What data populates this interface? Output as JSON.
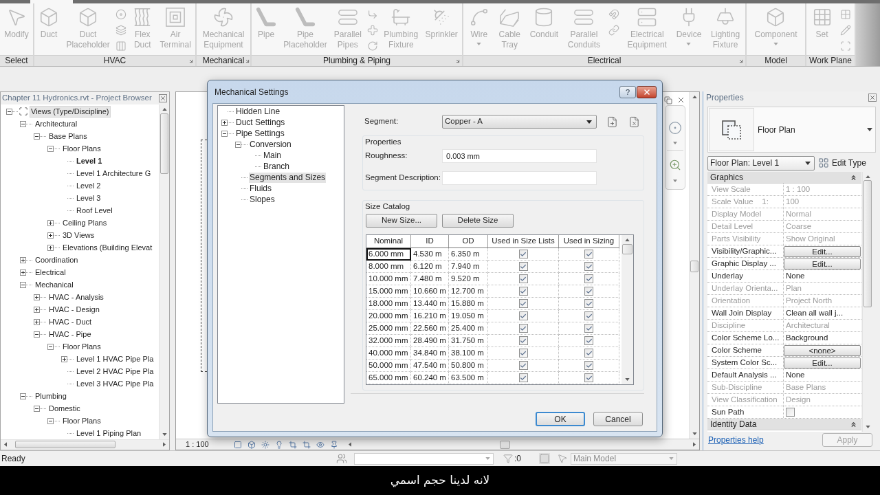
{
  "ribbon": {
    "panels": [
      {
        "title": "Select",
        "launcher": false,
        "items": [
          {
            "kind": "large",
            "label": "Modify",
            "dropdown": false,
            "disabled": true
          }
        ]
      },
      {
        "title": "HVAC",
        "launcher": true,
        "items": [
          {
            "kind": "large",
            "label": "Duct",
            "dropdown": false,
            "disabled": true
          },
          {
            "kind": "large",
            "label": "Duct Placeholder",
            "dropdown": false,
            "disabled": true
          },
          {
            "kind": "stack"
          },
          {
            "kind": "large",
            "label": "Flex Duct",
            "dropdown": false,
            "disabled": true
          },
          {
            "kind": "large",
            "label": "Air Terminal",
            "dropdown": false,
            "disabled": true
          }
        ]
      },
      {
        "title": "Mechanical",
        "launcher": true,
        "items": [
          {
            "kind": "large",
            "label": "Mechanical Equipment",
            "dropdown": false,
            "disabled": true
          }
        ]
      },
      {
        "title": "Plumbing & Piping",
        "launcher": true,
        "items": [
          {
            "kind": "large",
            "label": "Pipe",
            "dropdown": false,
            "disabled": true
          },
          {
            "kind": "large",
            "label": "Pipe Placeholder",
            "dropdown": false,
            "disabled": true
          },
          {
            "kind": "large",
            "label": "Parallel Pipes",
            "dropdown": false,
            "disabled": true
          },
          {
            "kind": "stack"
          },
          {
            "kind": "large",
            "label": "Plumbing Fixture",
            "dropdown": false,
            "disabled": true
          },
          {
            "kind": "large",
            "label": "Sprinkler",
            "dropdown": false,
            "disabled": true
          }
        ]
      },
      {
        "title": "Electrical",
        "launcher": true,
        "items": [
          {
            "kind": "large",
            "label": "Wire",
            "dropdown": true,
            "disabled": true
          },
          {
            "kind": "large",
            "label": "Cable Tray",
            "dropdown": false,
            "disabled": true
          },
          {
            "kind": "large",
            "label": "Conduit",
            "dropdown": false,
            "disabled": true
          },
          {
            "kind": "large",
            "label": "Parallel Conduits",
            "dropdown": false,
            "disabled": true
          },
          {
            "kind": "stack"
          },
          {
            "kind": "large",
            "label": "Electrical Equipment",
            "dropdown": false,
            "disabled": true
          },
          {
            "kind": "large",
            "label": "Device",
            "dropdown": true,
            "disabled": true
          },
          {
            "kind": "large",
            "label": "Lighting Fixture",
            "dropdown": false,
            "disabled": true
          }
        ]
      },
      {
        "title": "Model",
        "launcher": false,
        "items": [
          {
            "kind": "large",
            "label": "Component",
            "dropdown": true,
            "disabled": true
          }
        ]
      },
      {
        "title": "Work Plane",
        "launcher": false,
        "items": [
          {
            "kind": "large",
            "label": "Set",
            "dropdown": false,
            "disabled": true
          },
          {
            "kind": "stack"
          }
        ]
      }
    ]
  },
  "project_browser": {
    "title": "Chapter 11 Hydronics.rvt - Project Browser",
    "tree": [
      {
        "label": "Views (Type/Discipline)",
        "expanded": true,
        "selected": true,
        "children": [
          {
            "label": "Architectural",
            "expanded": true,
            "children": [
              {
                "label": "Base Plans",
                "expanded": true,
                "children": [
                  {
                    "label": "Floor Plans",
                    "expanded": true,
                    "children": [
                      {
                        "label": "Level 1",
                        "active": true
                      },
                      {
                        "label": "Level 1 Architecture G",
                        "active": false
                      },
                      {
                        "label": "Level 2",
                        "active": false
                      },
                      {
                        "label": "Level 3",
                        "active": false
                      },
                      {
                        "label": "Roof Level",
                        "active": false
                      }
                    ]
                  },
                  {
                    "label": "Ceiling Plans",
                    "expanded": false
                  },
                  {
                    "label": "3D Views",
                    "expanded": false
                  },
                  {
                    "label": "Elevations (Building Elevat",
                    "expanded": false
                  }
                ]
              }
            ]
          },
          {
            "label": "Coordination",
            "expanded": false
          },
          {
            "label": "Electrical",
            "expanded": false
          },
          {
            "label": "Mechanical",
            "expanded": true,
            "children": [
              {
                "label": "HVAC - Analysis",
                "expanded": false
              },
              {
                "label": "HVAC - Design",
                "expanded": false
              },
              {
                "label": "HVAC - Duct",
                "expanded": false
              },
              {
                "label": "HVAC - Pipe",
                "expanded": true,
                "children": [
                  {
                    "label": "Floor Plans",
                    "expanded": true,
                    "children": [
                      {
                        "label": "Level 1 HVAC Pipe Pla",
                        "expanded": false
                      },
                      {
                        "label": "Level 2 HVAC Pipe Pla"
                      },
                      {
                        "label": "Level 3 HVAC Pipe Pla"
                      }
                    ]
                  }
                ]
              }
            ]
          },
          {
            "label": "Plumbing",
            "expanded": true,
            "children": [
              {
                "label": "Domestic",
                "expanded": true,
                "children": [
                  {
                    "label": "Floor Plans",
                    "expanded": true,
                    "children": [
                      {
                        "label": "Level 1 Piping Plan"
                      }
                    ]
                  }
                ]
              }
            ]
          }
        ]
      }
    ]
  },
  "view": {
    "scale": "1 : 100"
  },
  "dialog": {
    "title": "Mechanical Settings",
    "help_button": "?",
    "tree": [
      {
        "label": "Hidden Line",
        "selected": false
      },
      {
        "label": "Duct Settings",
        "expanded": false,
        "selected": false
      },
      {
        "label": "Pipe Settings",
        "expanded": true,
        "selected": false,
        "children": [
          {
            "label": "Conversion",
            "expanded": true,
            "selected": false,
            "children": [
              {
                "label": "Main",
                "selected": false
              },
              {
                "label": "Branch",
                "selected": false
              }
            ]
          },
          {
            "label": "Segments and Sizes",
            "selected": true
          },
          {
            "label": "Fluids",
            "selected": false
          },
          {
            "label": "Slopes",
            "selected": false
          }
        ]
      }
    ],
    "segment": {
      "label": "Segment:",
      "value": "Copper - A"
    },
    "properties": {
      "title": "Properties",
      "fields": [
        {
          "label": "Roughness:",
          "value": "0.003 mm"
        },
        {
          "label": "Segment Description:"
        }
      ]
    },
    "size_catalog": {
      "title": "Size Catalog",
      "buttons": [
        "New Size...",
        "Delete Size"
      ],
      "columns": [
        "Nominal",
        "ID",
        "OD",
        "Used in Size Lists",
        "Used in Sizing"
      ],
      "rows": [
        {
          "nominal": "6.000 mm",
          "id": "4.530 m",
          "od": "6.350 m",
          "used_in_size_lists": true,
          "used_in_sizing": true,
          "focused": true
        },
        {
          "nominal": "8.000 mm",
          "id": "6.120 m",
          "od": "7.940 m",
          "used_in_size_lists": true,
          "used_in_sizing": true,
          "focused": false
        },
        {
          "nominal": "10.000 mm",
          "id": "7.480 m",
          "od": "9.520 m",
          "used_in_size_lists": true,
          "used_in_sizing": true,
          "focused": false
        },
        {
          "nominal": "15.000 mm",
          "id": "10.660 m",
          "od": "12.700 m",
          "used_in_size_lists": true,
          "used_in_sizing": true,
          "focused": false
        },
        {
          "nominal": "18.000 mm",
          "id": "13.440 m",
          "od": "15.880 m",
          "used_in_size_lists": true,
          "used_in_sizing": true,
          "focused": false
        },
        {
          "nominal": "20.000 mm",
          "id": "16.210 m",
          "od": "19.050 m",
          "used_in_size_lists": true,
          "used_in_sizing": true,
          "focused": false
        },
        {
          "nominal": "25.000 mm",
          "id": "22.560 m",
          "od": "25.400 m",
          "used_in_size_lists": true,
          "used_in_sizing": true,
          "focused": false
        },
        {
          "nominal": "32.000 mm",
          "id": "28.490 m",
          "od": "31.750 m",
          "used_in_size_lists": true,
          "used_in_sizing": true,
          "focused": false
        },
        {
          "nominal": "40.000 mm",
          "id": "34.840 m",
          "od": "38.100 m",
          "used_in_size_lists": true,
          "used_in_sizing": true,
          "focused": false
        },
        {
          "nominal": "50.000 mm",
          "id": "47.540 m",
          "od": "50.800 m",
          "used_in_size_lists": true,
          "used_in_sizing": true,
          "focused": false
        },
        {
          "nominal": "65.000 mm",
          "id": "60.240 m",
          "od": "63.500 m",
          "used_in_size_lists": true,
          "used_in_sizing": true,
          "focused": false
        }
      ]
    },
    "buttons": [
      {
        "label": "OK",
        "default": true
      },
      {
        "label": "Cancel",
        "default": false
      }
    ]
  },
  "properties": {
    "title": "Properties",
    "type_name": "Floor Plan",
    "instance": "Floor Plan: Level 1",
    "edit_type": "Edit Type",
    "groups": [
      {
        "title": "Graphics",
        "expanded": true,
        "rows": [
          {
            "name": "View Scale",
            "kind": "text",
            "value": "1 : 100",
            "disabled": true
          },
          {
            "name": "Scale Value    1:",
            "kind": "text",
            "value": "100",
            "disabled": true
          },
          {
            "name": "Display Model",
            "kind": "text",
            "value": "Normal",
            "disabled": true
          },
          {
            "name": "Detail Level",
            "kind": "text",
            "value": "Coarse",
            "disabled": true
          },
          {
            "name": "Parts Visibility",
            "kind": "text",
            "value": "Show Original",
            "disabled": true
          },
          {
            "name": "Visibility/Graphic...",
            "kind": "button",
            "value": "Edit...",
            "disabled": false
          },
          {
            "name": "Graphic Display ...",
            "kind": "button",
            "value": "Edit...",
            "disabled": false
          },
          {
            "name": "Underlay",
            "kind": "text",
            "value": "None",
            "disabled": false
          },
          {
            "name": "Underlay Orienta...",
            "kind": "text",
            "value": "Plan",
            "disabled": true
          },
          {
            "name": "Orientation",
            "kind": "text",
            "value": "Project North",
            "disabled": true
          },
          {
            "name": "Wall Join Display",
            "kind": "text",
            "value": "Clean all wall j...",
            "disabled": false
          },
          {
            "name": "Discipline",
            "kind": "text",
            "value": "Architectural",
            "disabled": true
          },
          {
            "name": "Color Scheme Lo...",
            "kind": "text",
            "value": "Background",
            "disabled": false
          },
          {
            "name": "Color Scheme",
            "kind": "button",
            "value": "<none>",
            "disabled": false
          },
          {
            "name": "System Color Sc...",
            "kind": "button",
            "value": "Edit...",
            "disabled": false
          },
          {
            "name": "Default Analysis ...",
            "kind": "text",
            "value": "None",
            "disabled": false
          },
          {
            "name": "Sub-Discipline",
            "kind": "text",
            "value": "Base Plans",
            "disabled": true
          },
          {
            "name": "View Classification",
            "kind": "text",
            "value": "Design",
            "disabled": true
          },
          {
            "name": "Sun Path",
            "kind": "checkbox",
            "checked": false,
            "disabled": false
          }
        ]
      },
      {
        "title": "Identity Data",
        "expanded": true
      }
    ],
    "help_link": "Properties help",
    "apply": {
      "label": "Apply",
      "disabled": true
    }
  },
  "status_bar": {
    "status": "Ready",
    "count": ":0",
    "model_selector": {
      "value": "Main Model",
      "disabled": true
    }
  },
  "subtitle": "لانه لدينا حجم اسمي"
}
